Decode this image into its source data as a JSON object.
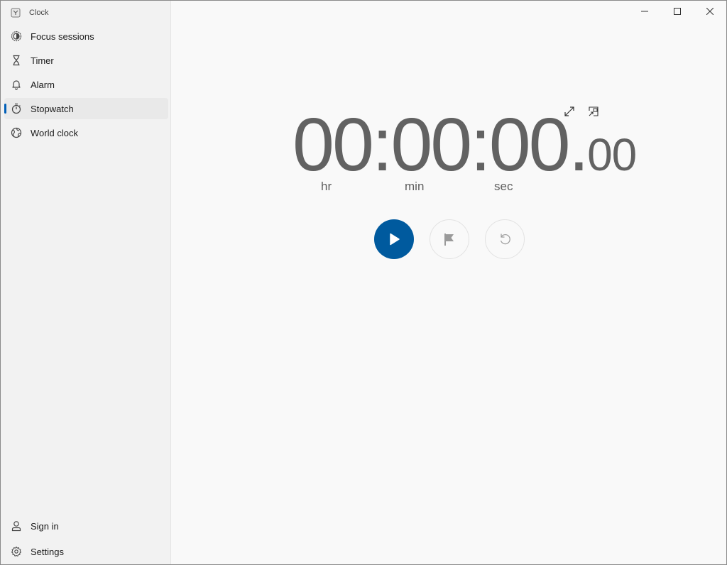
{
  "app": {
    "title": "Clock"
  },
  "window_controls": {
    "minimize": "minimize",
    "maximize": "maximize",
    "close": "close"
  },
  "sidebar": {
    "items": [
      {
        "label": "Focus sessions",
        "icon": "focus-icon",
        "selected": false
      },
      {
        "label": "Timer",
        "icon": "hourglass-icon",
        "selected": false
      },
      {
        "label": "Alarm",
        "icon": "bell-icon",
        "selected": false
      },
      {
        "label": "Stopwatch",
        "icon": "stopwatch-icon",
        "selected": true
      },
      {
        "label": "World clock",
        "icon": "globe-icon",
        "selected": false
      }
    ],
    "footer": [
      {
        "label": "Sign in",
        "icon": "person-icon"
      },
      {
        "label": "Settings",
        "icon": "gear-icon"
      }
    ]
  },
  "stopwatch": {
    "hours": "00",
    "minutes": "00",
    "seconds": "00",
    "separator": ":",
    "decimal": ".",
    "hundredths": "00",
    "labels": {
      "hr": "hr",
      "min": "min",
      "sec": "sec"
    },
    "accent_color": "#005a9e"
  },
  "controls": {
    "start": "Start",
    "lap": "Lap",
    "reset": "Reset"
  }
}
